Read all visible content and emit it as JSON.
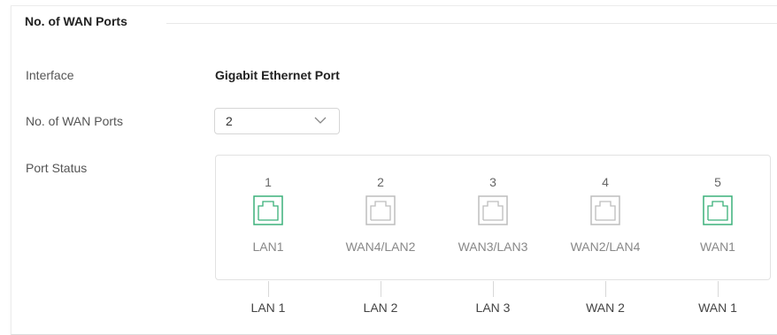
{
  "section": {
    "title": "No. of WAN Ports"
  },
  "interface": {
    "label": "Interface",
    "value": "Gigabit Ethernet Port"
  },
  "wan_ports": {
    "label": "No. of WAN Ports",
    "selected": "2"
  },
  "port_status": {
    "label": "Port Status",
    "ports": [
      {
        "number": "1",
        "label": "LAN1",
        "connected": true,
        "bottom": "LAN 1"
      },
      {
        "number": "2",
        "label": "WAN4/LAN2",
        "connected": false,
        "bottom": "LAN 2"
      },
      {
        "number": "3",
        "label": "WAN3/LAN3",
        "connected": false,
        "bottom": "LAN 3"
      },
      {
        "number": "4",
        "label": "WAN2/LAN4",
        "connected": false,
        "bottom": "WAN 2"
      },
      {
        "number": "5",
        "label": "WAN1",
        "connected": true,
        "bottom": "WAN 1"
      }
    ]
  },
  "colors": {
    "connected": "#3bb07a",
    "disconnected": "#bdbdbd"
  }
}
